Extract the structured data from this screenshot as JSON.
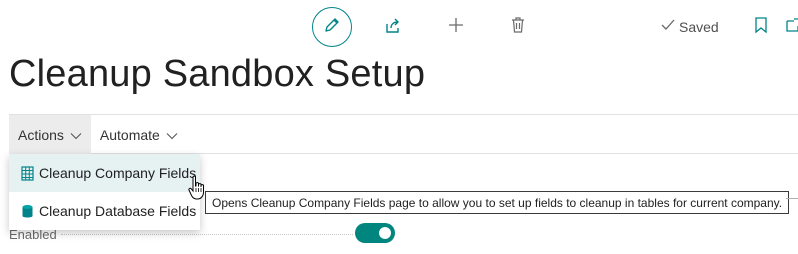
{
  "toolbar": {
    "icons": [
      "edit-icon",
      "share-icon",
      "plus-icon",
      "delete-icon",
      "checkmark-icon",
      "bookmark-icon",
      "popout-icon"
    ],
    "saved_label": "Saved"
  },
  "page": {
    "title": "Cleanup Sandbox Setup"
  },
  "action_bar": {
    "tabs": [
      {
        "label": "Actions",
        "active": true
      },
      {
        "label": "Automate",
        "active": false
      }
    ]
  },
  "actions_menu": {
    "items": [
      {
        "label": "Cleanup Company Fields",
        "icon": "table-icon",
        "hovered": true
      },
      {
        "label": "Cleanup Database Fields",
        "icon": "database-icon",
        "hovered": false
      }
    ]
  },
  "tooltip": {
    "text": "Opens Cleanup Company Fields page to allow you to set up fields to cleanup in tables for current company."
  },
  "fields": {
    "enabled": {
      "label": "Enabled",
      "value": true
    }
  },
  "colors": {
    "accent": "#008489",
    "toggle_on": "#00857f",
    "menu_hover": "#e6f2f2",
    "active_tab": "#ececec"
  }
}
